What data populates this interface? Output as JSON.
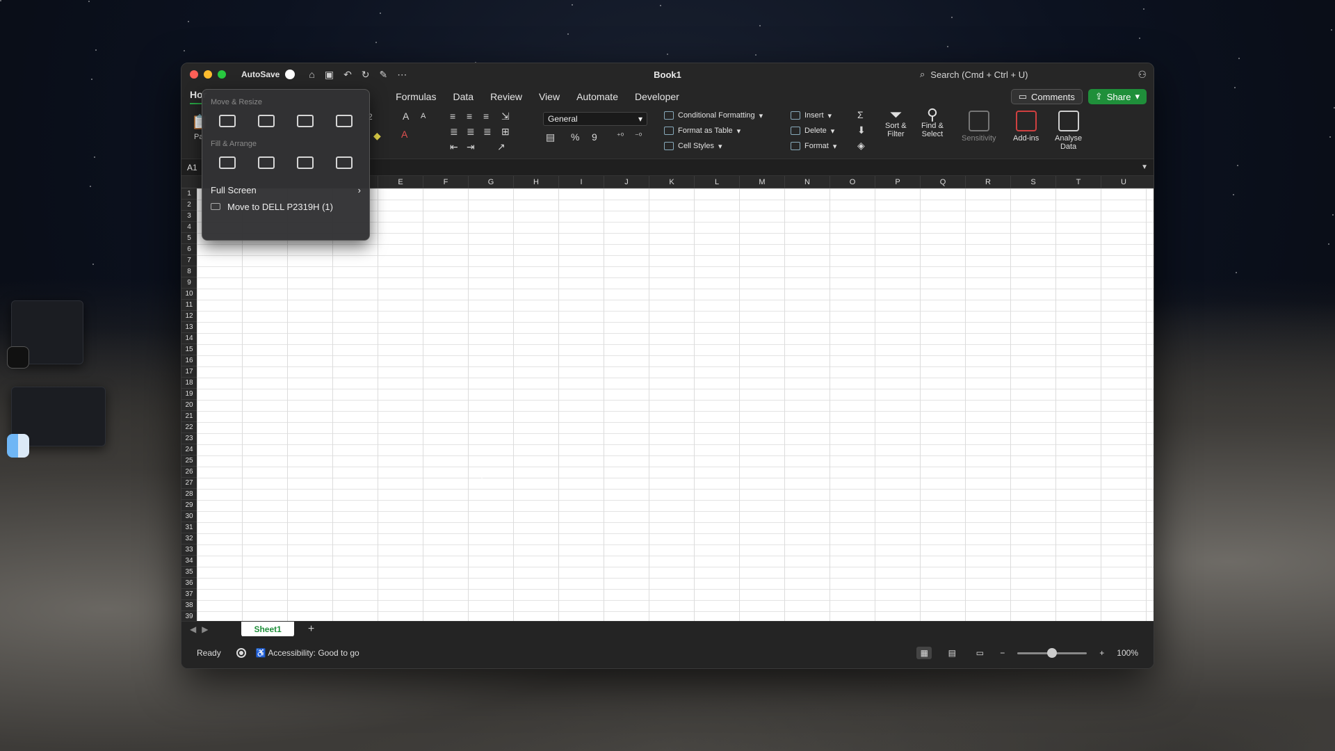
{
  "window": {
    "title": "Book1",
    "autosave_label": "AutoSave",
    "search_placeholder": "Search (Cmd + Ctrl + U)"
  },
  "tabs": [
    "Hor",
    "Formulas",
    "Data",
    "Review",
    "View",
    "Automate",
    "Developer"
  ],
  "buttons": {
    "comments": "Comments",
    "share": "Share"
  },
  "ribbon": {
    "paste_label": "Pa",
    "font_size": "2",
    "number_format": "General",
    "percent_symbol": "%",
    "comma_symbol": "9",
    "conditional_formatting": "Conditional Formatting",
    "format_as_table": "Format as Table",
    "cell_styles": "Cell Styles",
    "insert": "Insert",
    "delete": "Delete",
    "format": "Format",
    "sort_filter_1": "Sort &",
    "sort_filter_2": "Filter",
    "find_select_1": "Find &",
    "find_select_2": "Select",
    "sensitivity": "Sensitivity",
    "add_ins": "Add-ins",
    "analyse_1": "Analyse",
    "analyse_2": "Data"
  },
  "formula_bar": {
    "namebox": "A1"
  },
  "columns": [
    "E",
    "F",
    "G",
    "H",
    "I",
    "J",
    "K",
    "L",
    "M",
    "N",
    "O",
    "P",
    "Q",
    "R",
    "S",
    "T",
    "U"
  ],
  "rows": [
    "1",
    "2",
    "3",
    "4",
    "5",
    "6",
    "7",
    "8",
    "9",
    "10",
    "11",
    "12",
    "13",
    "14",
    "15",
    "16",
    "17",
    "18",
    "19",
    "20",
    "21",
    "22",
    "23",
    "24",
    "25",
    "26",
    "27",
    "28",
    "29",
    "30",
    "31",
    "32",
    "33",
    "34",
    "35",
    "36",
    "37",
    "38",
    "39"
  ],
  "sheet": {
    "tab": "Sheet1",
    "add": "+"
  },
  "status": {
    "ready": "Ready",
    "accessibility": "Accessibility: Good to go",
    "zoom": "100%",
    "zoom_fraction": 0.5
  },
  "popup": {
    "section1": "Move & Resize",
    "section2": "Fill & Arrange",
    "full_screen": "Full Screen",
    "move_to": "Move to DELL P2319H (1)"
  }
}
